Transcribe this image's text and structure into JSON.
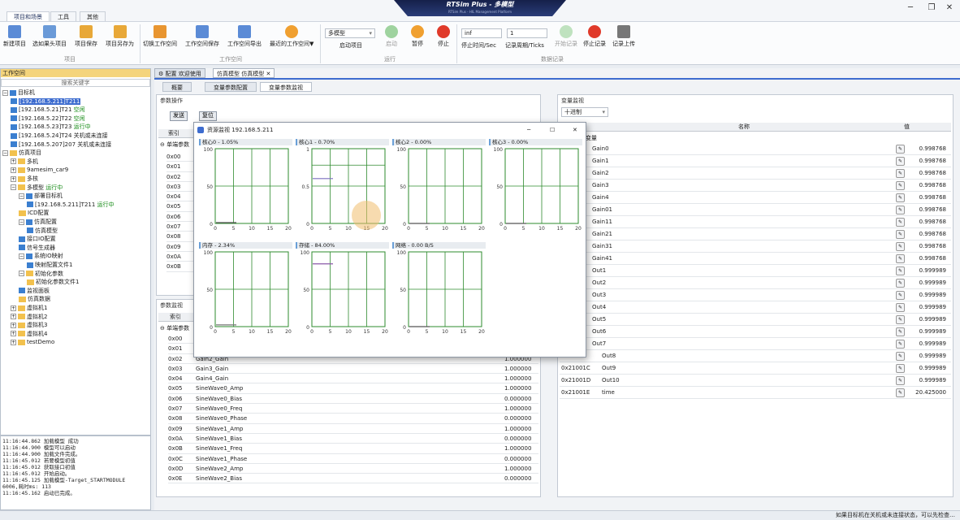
{
  "window": {
    "title": "RTSim Plus - 多模型",
    "subtitle": "RTSim Plus - HIL Management Platform"
  },
  "ribbon_tabs": [
    "项目和场景",
    "工具",
    "其他"
  ],
  "ribbon": {
    "groups": [
      {
        "label": "项目",
        "buttons": [
          "新建项目",
          "选如果头项目",
          "项目保存",
          "项目另存为"
        ]
      },
      {
        "label": "工作空间",
        "buttons": [
          "切换工作空间",
          "工作空间保存",
          "工作空间导出",
          "最近的工作空间▼"
        ]
      },
      {
        "label": "运行",
        "buttons": [
          "启动项目",
          "启动",
          "暂停",
          "停止"
        ]
      },
      {
        "label": "数据记录",
        "buttons": [
          "停止时间/Sec",
          "记录周期/Ticks",
          "开始记录",
          "停止记录",
          "记录上传"
        ]
      }
    ],
    "model_select": "多模型",
    "stop_time": "inf",
    "record_period": "1"
  },
  "left_panel": {
    "title": "工作空间",
    "search_placeholder": "搜索关键字",
    "tree": [
      {
        "indent": 0,
        "ex": "⊟",
        "icon": "mi",
        "text": "目标机"
      },
      {
        "indent": 1,
        "icon": "mi",
        "text": "[192.168.5.211]T211",
        "selected": true
      },
      {
        "indent": 1,
        "icon": "mi",
        "text": "[192.168.5.21]T21",
        "status": "空闲"
      },
      {
        "indent": 1,
        "icon": "mi",
        "text": "[192.168.5.22]T22",
        "status": "空闲"
      },
      {
        "indent": 1,
        "icon": "mi",
        "text": "[192.168.5.23]T23",
        "status": "运行中"
      },
      {
        "indent": 1,
        "icon": "mi",
        "text": "[192.168.5.24]T24 关机或未连接"
      },
      {
        "indent": 1,
        "icon": "mi",
        "text": "[192.168.5.207]207 关机或未连接"
      },
      {
        "indent": 0,
        "ex": "⊟",
        "icon": "fi",
        "text": "仿真项目"
      },
      {
        "indent": 1,
        "ex": "⊞",
        "icon": "fi",
        "text": "多机"
      },
      {
        "indent": 1,
        "ex": "⊞",
        "icon": "fi",
        "text": "9amesim_car9"
      },
      {
        "indent": 1,
        "ex": "⊞",
        "icon": "fi",
        "text": "多核"
      },
      {
        "indent": 1,
        "ex": "⊟",
        "icon": "fi",
        "text": "多模型",
        "status": "运行中"
      },
      {
        "indent": 2,
        "ex": "⊟",
        "icon": "mi",
        "text": "部署目标机"
      },
      {
        "indent": 3,
        "icon": "mi",
        "text": "[192.168.5.211]T211",
        "status": "运行中"
      },
      {
        "indent": 2,
        "icon": "fi",
        "text": "ICD配置"
      },
      {
        "indent": 2,
        "ex": "⊟",
        "icon": "mi",
        "text": "仿真配置"
      },
      {
        "indent": 3,
        "icon": "mi",
        "text": "仿真模型"
      },
      {
        "indent": 2,
        "icon": "mi",
        "text": "接口IO配置"
      },
      {
        "indent": 2,
        "icon": "mi",
        "text": "信号生成器"
      },
      {
        "indent": 2,
        "ex": "⊟",
        "icon": "mi",
        "text": "系统IO映射"
      },
      {
        "indent": 3,
        "icon": "mi",
        "text": "映射配置文件1"
      },
      {
        "indent": 2,
        "ex": "⊟",
        "icon": "fi",
        "text": "初始化参数"
      },
      {
        "indent": 3,
        "icon": "fi",
        "text": "初始化参数文件1"
      },
      {
        "indent": 2,
        "icon": "mi",
        "text": "监视面板"
      },
      {
        "indent": 2,
        "icon": "fi",
        "text": "仿真数据"
      },
      {
        "indent": 1,
        "ex": "⊞",
        "icon": "fi",
        "text": "虚拟机1"
      },
      {
        "indent": 1,
        "ex": "⊞",
        "icon": "fi",
        "text": "虚拟机2"
      },
      {
        "indent": 1,
        "ex": "⊞",
        "icon": "fi",
        "text": "虚拟机3"
      },
      {
        "indent": 1,
        "ex": "⊞",
        "icon": "fi",
        "text": "虚拟机4"
      },
      {
        "indent": 1,
        "ex": "⊞",
        "icon": "fi",
        "text": "testDemo"
      }
    ]
  },
  "log": [
    "11:16:44.862 加载模型 成功",
    "11:16:44.900 模型可以启动",
    "11:16:44.900 加载文件完成。",
    "11:16:45.012 若要模型初值",
    "11:16:45.012 获取接口初值",
    "11:16:45.012 开始启动。",
    "11:16:45.125 加载模型-Target_STARTMODULE",
    "6006,耗时ms: 113",
    "11:16:45.162 启动已完成。"
  ],
  "doc_tabs": [
    "配置 欢迎使用",
    "仿真模型 仿真模型"
  ],
  "sub_tabs": [
    "概要",
    "变量参数配置",
    "变量参数监视"
  ],
  "param_ops": {
    "title": "参数操作",
    "send": "发送",
    "reset": "复位",
    "col_index": "索引",
    "group": "单端参数",
    "rows": [
      "0x00",
      "0x01",
      "0x02",
      "0x03",
      "0x04",
      "0x05",
      "0x06",
      "0x07",
      "0x08",
      "0x09",
      "0x0A",
      "0x0B"
    ]
  },
  "param_monitor": {
    "title": "参数监视",
    "col_index": "索引",
    "group": "单端参数",
    "rows": [
      {
        "idx": "0x00",
        "name": "",
        "val": ""
      },
      {
        "idx": "0x01",
        "name": "",
        "val": ""
      },
      {
        "idx": "0x02",
        "name": "Gain2_Gain",
        "val": "1.000000"
      },
      {
        "idx": "0x03",
        "name": "Gain3_Gain",
        "val": "1.000000"
      },
      {
        "idx": "0x04",
        "name": "Gain4_Gain",
        "val": "1.000000"
      },
      {
        "idx": "0x05",
        "name": "SineWave0_Amp",
        "val": "1.000000"
      },
      {
        "idx": "0x06",
        "name": "SineWave0_Bias",
        "val": "0.000000"
      },
      {
        "idx": "0x07",
        "name": "SineWave0_Freq",
        "val": "1.000000"
      },
      {
        "idx": "0x08",
        "name": "SineWave0_Phase",
        "val": "0.000000"
      },
      {
        "idx": "0x09",
        "name": "SineWave1_Amp",
        "val": "1.000000"
      },
      {
        "idx": "0x0A",
        "name": "SineWave1_Bias",
        "val": "0.000000"
      },
      {
        "idx": "0x0B",
        "name": "SineWave1_Freq",
        "val": "1.000000"
      },
      {
        "idx": "0x0C",
        "name": "SineWave1_Phase",
        "val": "0.000000"
      },
      {
        "idx": "0x0D",
        "name": "SineWave2_Amp",
        "val": "1.000000"
      },
      {
        "idx": "0x0E",
        "name": "SineWave2_Bias",
        "val": "0.000000"
      }
    ]
  },
  "var_monitor": {
    "title": "变量监视",
    "format": "十进制",
    "col_name": "名称",
    "col_value": "值",
    "group": "变量",
    "rows": [
      {
        "idx": "19",
        "name": "Gain0",
        "val": "0.998768"
      },
      {
        "idx": "1A",
        "name": "Gain1",
        "val": "0.998768"
      },
      {
        "idx": "1B",
        "name": "Gain2",
        "val": "0.998768"
      },
      {
        "idx": "1C",
        "name": "Gain3",
        "val": "0.998768"
      },
      {
        "idx": "1D",
        "name": "Gain4",
        "val": "0.998768"
      },
      {
        "idx": "19",
        "name": "Gain01",
        "val": "0.998768"
      },
      {
        "idx": "1A",
        "name": "Gain11",
        "val": "0.998768"
      },
      {
        "idx": "1B",
        "name": "Gain21",
        "val": "0.998768"
      },
      {
        "idx": "1C",
        "name": "Gain31",
        "val": "0.998768"
      },
      {
        "idx": "1D",
        "name": "Gain41",
        "val": "0.998768"
      },
      {
        "idx": "14",
        "name": "Out1",
        "val": "0.999989"
      },
      {
        "idx": "15",
        "name": "Out2",
        "val": "0.999989"
      },
      {
        "idx": "16",
        "name": "Out3",
        "val": "0.999989"
      },
      {
        "idx": "17",
        "name": "Out4",
        "val": "0.999989"
      },
      {
        "idx": "18",
        "name": "Out5",
        "val": "0.999989"
      },
      {
        "idx": "19",
        "name": "Out6",
        "val": "0.999989"
      },
      {
        "idx": "1A",
        "name": "Out7",
        "val": "0.999989"
      },
      {
        "idx": "0x2101B",
        "name": "Out8",
        "val": "0.999989"
      },
      {
        "idx": "0x21001C",
        "name": "Out9",
        "val": "0.999989"
      },
      {
        "idx": "0x21001D",
        "name": "Out10",
        "val": "0.999989"
      },
      {
        "idx": "0x21001E",
        "name": "time",
        "val": "20.425000"
      }
    ]
  },
  "dialog": {
    "title": "资源监视 192.168.5.211",
    "charts": [
      {
        "title": "核心0 - 1.05%",
        "yticks": [
          "100",
          "50",
          "0"
        ],
        "level": 1.05,
        "color": "#555"
      },
      {
        "title": "核心1 - 0.70%",
        "yticks": [
          "1",
          "0.5",
          "0"
        ],
        "level": 0.7,
        "color": "#7a6fbf"
      },
      {
        "title": "核心2 - 0.00%",
        "yticks": [
          "100",
          "50",
          "0"
        ],
        "level": 0,
        "color": "#555"
      },
      {
        "title": "核心3 - 0.00%",
        "yticks": [
          "100",
          "50",
          "0"
        ],
        "level": 0,
        "color": "#555"
      },
      {
        "title": "内存 - 2.34%",
        "yticks": [
          "100",
          "50",
          "0"
        ],
        "level": 2.34,
        "color": "#777"
      },
      {
        "title": "存储 - 84.00%",
        "yticks": [
          "100",
          "50",
          "0"
        ],
        "level": 84,
        "color": "#8a5aa8"
      },
      {
        "title": "网络 - 0.00 B/S",
        "yticks": [
          "100",
          "50",
          "0"
        ],
        "level": 0,
        "color": "#555"
      }
    ],
    "xticks": [
      "0",
      "5",
      "10",
      "15",
      "20"
    ]
  },
  "status_text": "如果目标机在关机或未连接状态，可以先检查…"
}
